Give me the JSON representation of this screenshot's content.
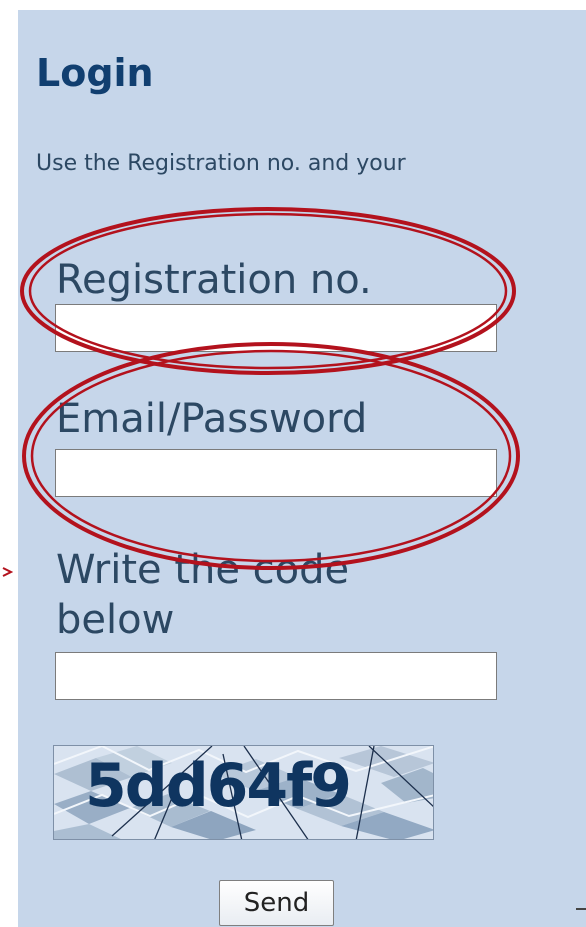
{
  "login": {
    "title": "Login",
    "intro": "Use the Registration no. and your",
    "registration_label": "Registration no.",
    "registration_value": "",
    "email_password_label": "Email/Password",
    "email_password_value": "",
    "code_label": "Write the code below",
    "code_value": "",
    "captcha_code": "5dd64f9",
    "send_label": "Send"
  },
  "theme": {
    "panel_bg": "#c6d6ea",
    "title_color": "#113f70",
    "text_color": "#2c4863",
    "annotation_red": "#b3121d"
  }
}
